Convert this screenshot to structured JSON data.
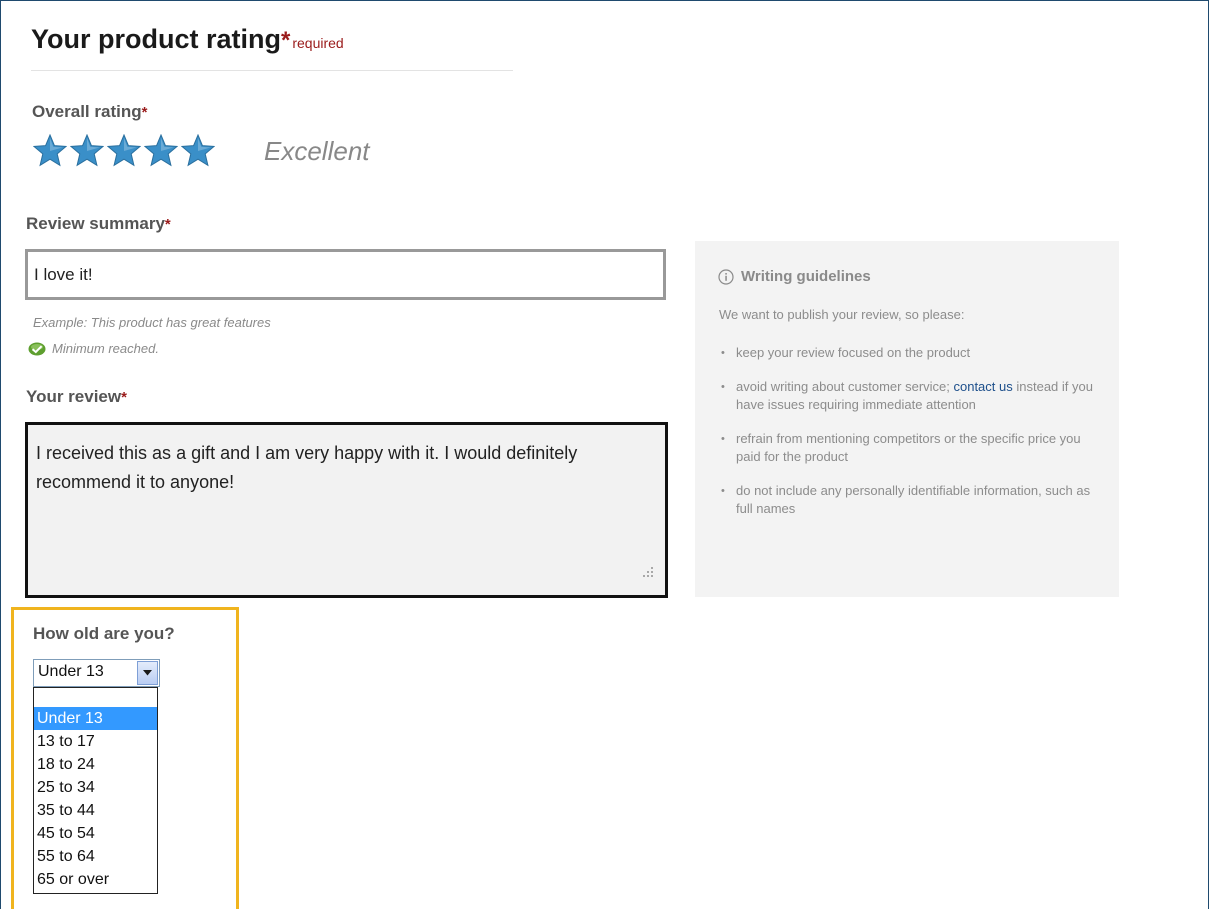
{
  "header": {
    "title": "Your product rating",
    "required_star": "*",
    "required_label": "required"
  },
  "rating": {
    "label": "Overall rating",
    "star": "*",
    "value": 5,
    "max": 5,
    "value_label": "Excellent",
    "star_color": "#3a8fc8"
  },
  "summary": {
    "label": "Review summary",
    "star": "*",
    "value": "I love it!",
    "example": "Example: This product has great features",
    "status": "Minimum reached.",
    "status_icon": "check-icon"
  },
  "review": {
    "label": "Your review",
    "star": "*",
    "value": "I received this as a gift and I am very happy with it. I would definitely recommend it to anyone!"
  },
  "guidelines": {
    "icon": "info-icon",
    "title": "Writing guidelines",
    "intro": "We want to publish your review, so please:",
    "items": [
      {
        "text": "keep your review focused on the product"
      },
      {
        "before": "avoid writing about customer service; ",
        "link": "contact us",
        "after": " instead if you have issues requiring immediate attention"
      },
      {
        "text": "refrain from mentioning competitors or the specific price you paid for the product"
      },
      {
        "text": "do not include any personally identifiable information, such as full names"
      }
    ]
  },
  "age": {
    "label": "How old are you?",
    "selected": "Under 13",
    "options": [
      "",
      "Under 13",
      "13 to 17",
      "18 to 24",
      "25 to 34",
      "35 to 44",
      "45 to 54",
      "55 to 64",
      "65 or over"
    ],
    "highlight_color": "#f0b41e",
    "selection_color": "#3399ff"
  }
}
